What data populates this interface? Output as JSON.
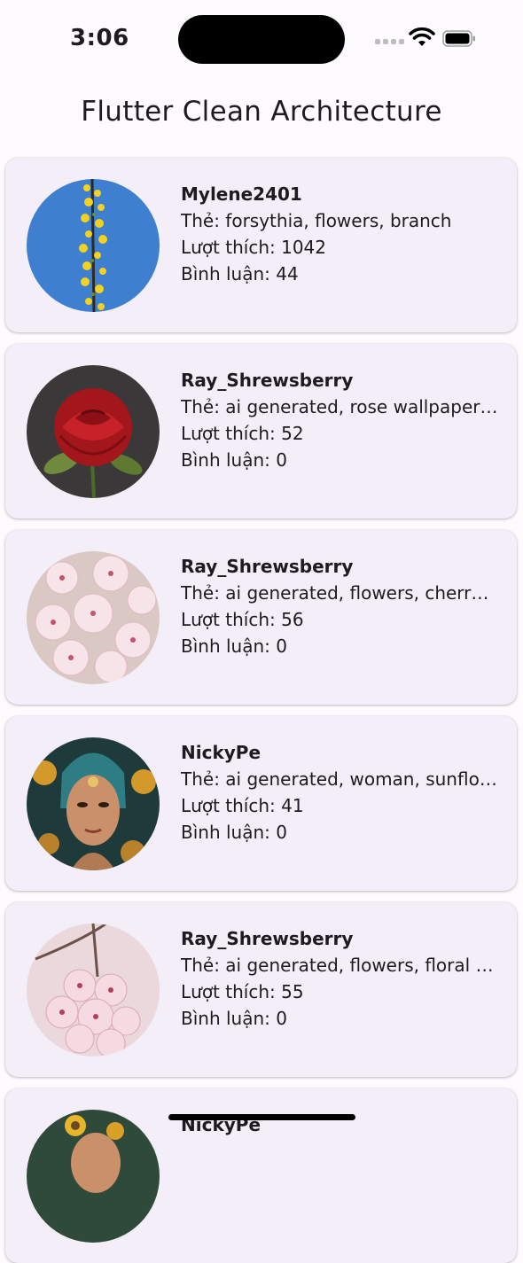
{
  "status_bar": {
    "time": "3:06"
  },
  "app_bar": {
    "title": "Flutter Clean Architecture"
  },
  "labels": {
    "tags": "Thẻ: ",
    "likes": "Lượt thích: ",
    "comments": "Bình luận: "
  },
  "posts": [
    {
      "user": "Mylene2401",
      "tags": "Thẻ: forsythia, flowers, branch",
      "likes": "Lượt thích: 1042",
      "comments": "Bình luận: 44",
      "image": "forsythia-branch"
    },
    {
      "user": "Ray_Shrewsberry",
      "tags": "Thẻ: ai generated, rose wallpaper, rose",
      "likes": "Lượt thích: 52",
      "comments": "Bình luận: 0",
      "image": "red-rose"
    },
    {
      "user": "Ray_Shrewsberry",
      "tags": "Thẻ: ai generated, flowers, cherry blossoms",
      "likes": "Lượt thích: 56",
      "comments": "Bình luận: 0",
      "image": "cherry-blossoms"
    },
    {
      "user": "NickyPe",
      "tags": "Thẻ: ai generated, woman, sunflowers",
      "likes": "Lượt thích: 41",
      "comments": "Bình luận: 0",
      "image": "woman-portrait"
    },
    {
      "user": "Ray_Shrewsberry",
      "tags": "Thẻ: ai generated, flowers, floral background",
      "likes": "Lượt thích: 55",
      "comments": "Bình luận: 0",
      "image": "pink-blossoms"
    },
    {
      "user": "NickyPe",
      "tags": "",
      "likes": "",
      "comments": "",
      "image": "sunflower-portrait"
    }
  ]
}
